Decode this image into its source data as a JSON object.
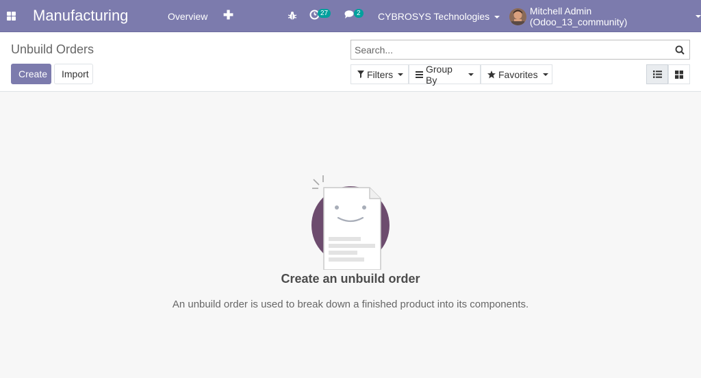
{
  "navbar": {
    "app_name": "Manufacturing",
    "menu_overview": "Overview",
    "activity_count": "27",
    "message_count": "2",
    "company": "CYBROSYS Technologies",
    "user": "Mitchell Admin (Odoo_13_community)"
  },
  "control_panel": {
    "breadcrumb": "Unbuild Orders",
    "create_label": "Create",
    "import_label": "Import",
    "search_placeholder": "Search...",
    "filters_label": "Filters",
    "groupby_label": "Group By",
    "favorites_label": "Favorites",
    "active_view": "list"
  },
  "help": {
    "title": "Create an unbuild order",
    "text": "An unbuild order is used to break down a finished product into its components."
  },
  "colors": {
    "navbar": "#7c7bad",
    "badge": "#00a09d",
    "illustration_circle": "#6d4c6e"
  },
  "icons": {
    "apps": "apps-grid-icon",
    "plus": "plus-icon",
    "debug": "bug-icon",
    "activity": "clock-icon",
    "messaging": "comments-icon",
    "search": "search-icon",
    "filters": "filter-icon",
    "groupby": "bars-icon",
    "favorites": "star-icon",
    "list_view": "list-view-icon",
    "kanban_view": "kanban-view-icon"
  }
}
